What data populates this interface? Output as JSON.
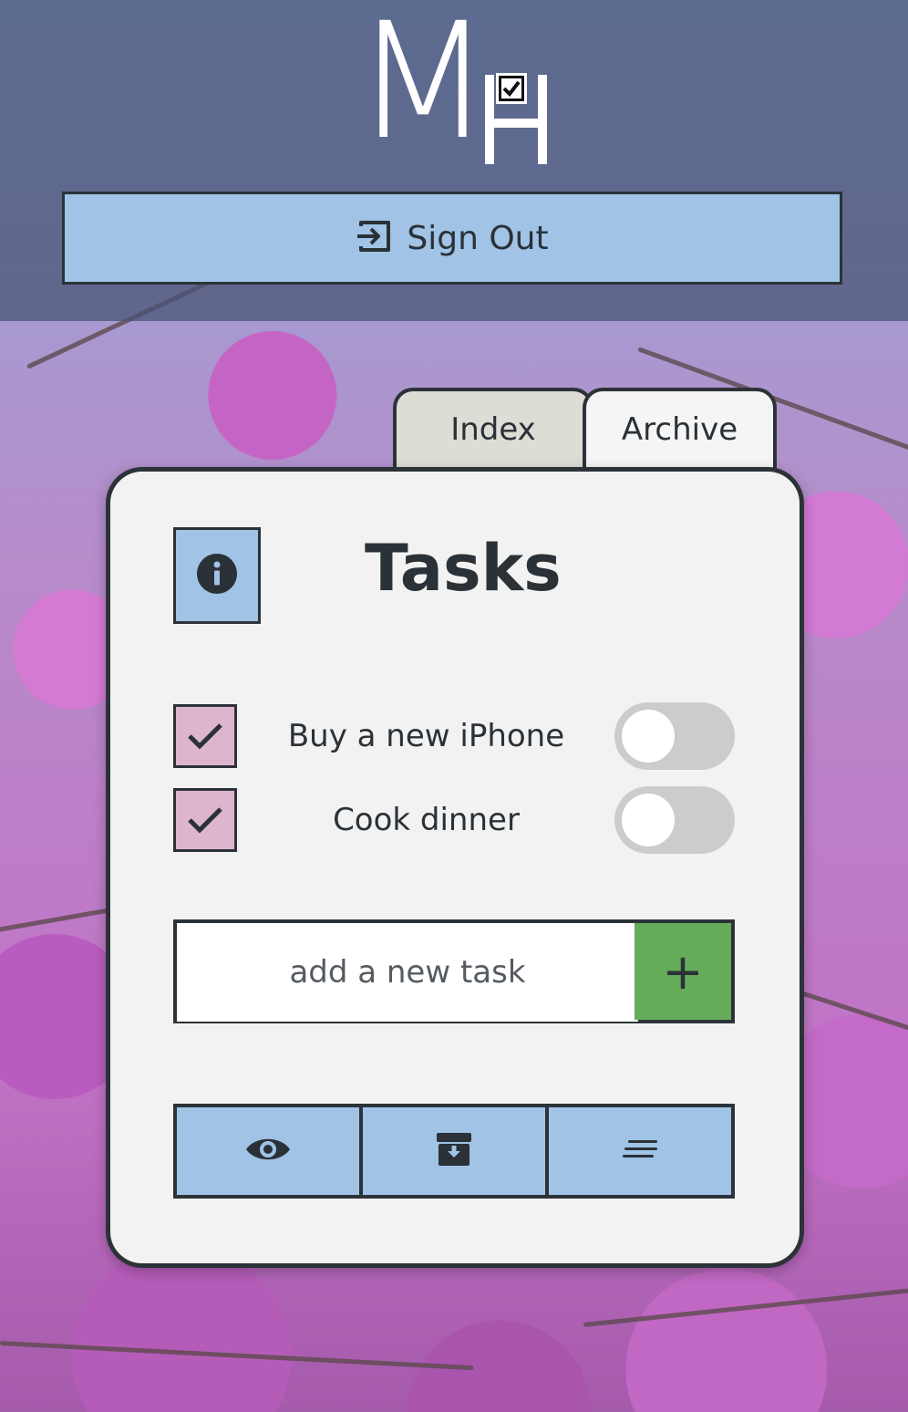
{
  "app": {
    "logo_letters": "MH"
  },
  "header": {
    "signout_label": "Sign Out"
  },
  "tabs": [
    {
      "label": "Index",
      "active": true
    },
    {
      "label": "Archive",
      "active": false
    }
  ],
  "card": {
    "title": "Tasks",
    "tasks": [
      {
        "text": "Buy a new iPhone",
        "checked": true,
        "toggle_on": false
      },
      {
        "text": "Cook dinner",
        "checked": true,
        "toggle_on": false
      }
    ],
    "new_task": {
      "placeholder": "add a new task",
      "value": "",
      "add_label": "+"
    },
    "toolbar": [
      {
        "icon": "eye-icon"
      },
      {
        "icon": "archive-box-icon"
      },
      {
        "icon": "sort-lines-icon"
      }
    ]
  },
  "colors": {
    "accent_blue": "#a0c3e6",
    "checkbox_pink": "#ddb6ce",
    "add_green": "#64ac5a",
    "card_bg": "#f2f2f2",
    "border_dark": "#2c3338"
  }
}
